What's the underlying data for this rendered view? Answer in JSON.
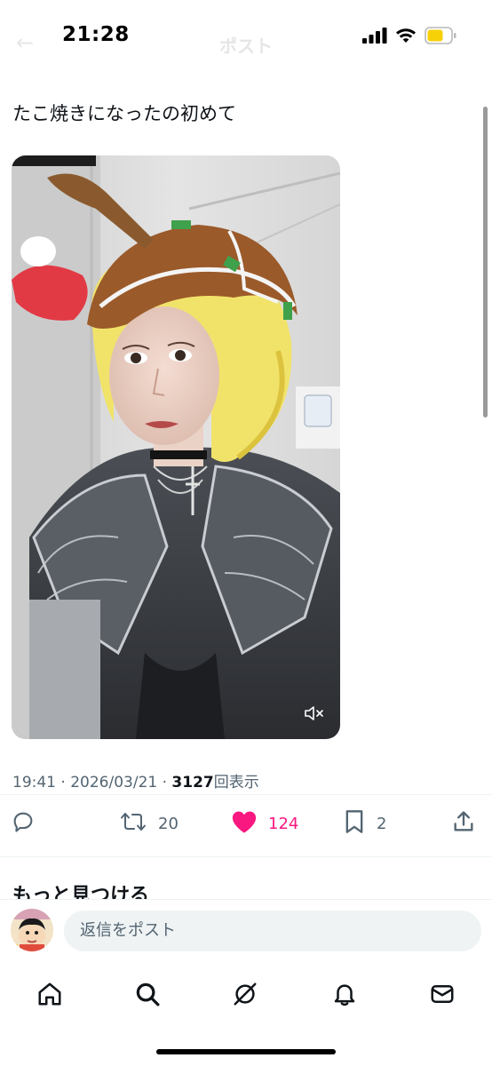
{
  "status_bar": {
    "time": "21:28"
  },
  "header": {
    "back_glyph": "←",
    "title": "ポスト"
  },
  "post": {
    "text": "たこ焼きになったの初めて",
    "media": {
      "type": "video",
      "description_icon": "mute-icon"
    },
    "time": "19:41",
    "date": "2026/03/21",
    "separator": "·",
    "views": "3127",
    "views_label": "回表示"
  },
  "actions": {
    "reply_icon": "reply-icon",
    "retweet_count": "20",
    "like_count": "124",
    "like_color": "#f91880",
    "bookmark_count": "2",
    "share_icon": "share-icon"
  },
  "discover": {
    "heading": "もっと見つける"
  },
  "reply": {
    "placeholder": "返信をポスト"
  },
  "tabbar": {
    "items": [
      "home-icon",
      "search-icon",
      "grok-icon",
      "notifications-icon",
      "messages-icon"
    ]
  },
  "colors": {
    "text": "#0f1419",
    "secondary": "#536471",
    "like": "#f91880",
    "battery": "#f7d108"
  }
}
